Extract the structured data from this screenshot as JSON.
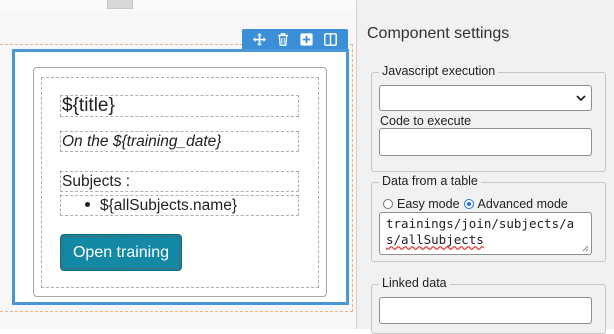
{
  "canvas": {
    "title_field": "${title}",
    "date_field": "On the ${training_date}",
    "subjects_label": "Subjects :",
    "subjects_item": "${allSubjects.name}",
    "open_button": "Open training",
    "toolbar": {
      "icons": [
        "move-icon",
        "trash-icon",
        "plus-icon",
        "columns-icon"
      ]
    }
  },
  "panel": {
    "title": "Component settings",
    "js_group": {
      "legend": "Javascript execution",
      "select_value": "",
      "code_label": "Code to execute",
      "code_value": ""
    },
    "table_group": {
      "legend": "Data from a table",
      "easy_mode": "Easy mode",
      "advanced_mode": "Advanced mode",
      "selected_mode": "Advanced mode",
      "query_line1": "trainings/join/subjects/a",
      "query_line2": "s/allSubjects"
    },
    "linked_group": {
      "legend": "Linked data",
      "value": ""
    }
  },
  "colors": {
    "selection_blue": "#4a97d8",
    "button_teal": "#1489a5",
    "panel_bg": "#f1f1f1"
  }
}
